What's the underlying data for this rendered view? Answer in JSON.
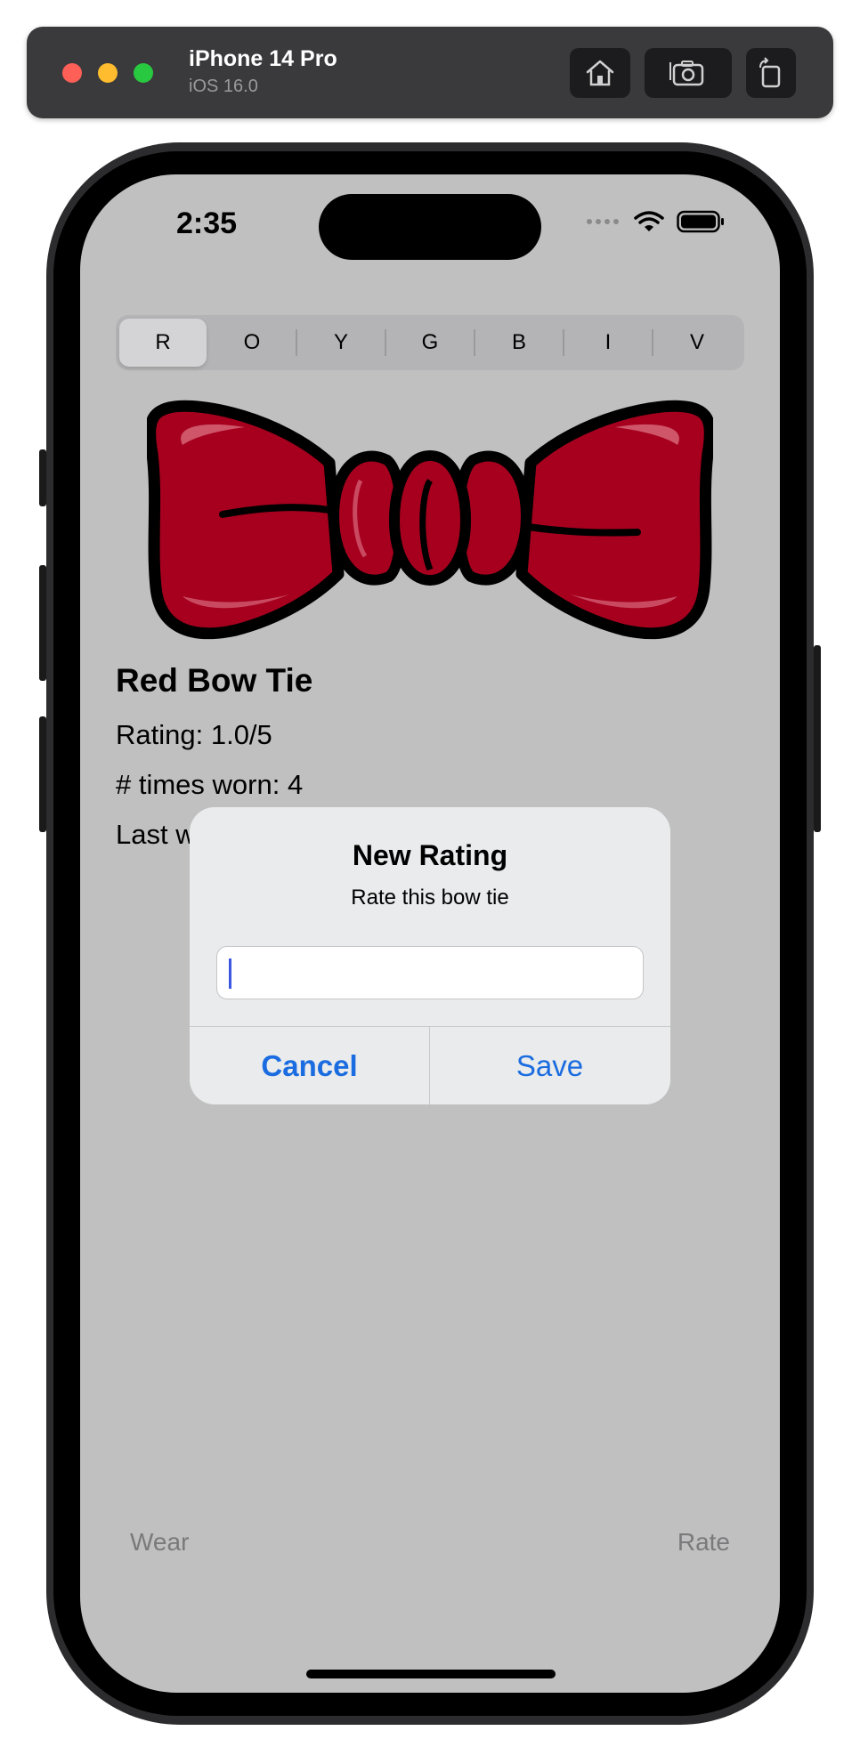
{
  "simulator": {
    "device_name": "iPhone 14 Pro",
    "os_version": "iOS 16.0",
    "buttons": [
      "home-icon",
      "screenshot-icon",
      "rotate-icon"
    ]
  },
  "status_bar": {
    "time": "2:35"
  },
  "segmented_control": {
    "selected": "R",
    "items": [
      "R",
      "O",
      "Y",
      "G",
      "B",
      "I",
      "V"
    ]
  },
  "bowtie": {
    "color": "#a6001e"
  },
  "details": {
    "title": "Red Bow Tie",
    "rating": "Rating: 1.0/5",
    "times_worn": "# times worn: 4",
    "last_worn": "Last w"
  },
  "alert": {
    "title": "New Rating",
    "message": "Rate this bow tie",
    "input_value": "",
    "cancel_label": "Cancel",
    "save_label": "Save"
  },
  "bottom_bar": {
    "wear_label": "Wear",
    "rate_label": "Rate"
  },
  "colors": {
    "accent": "#1a6ce0",
    "screen_background": "#c0c0c0"
  }
}
